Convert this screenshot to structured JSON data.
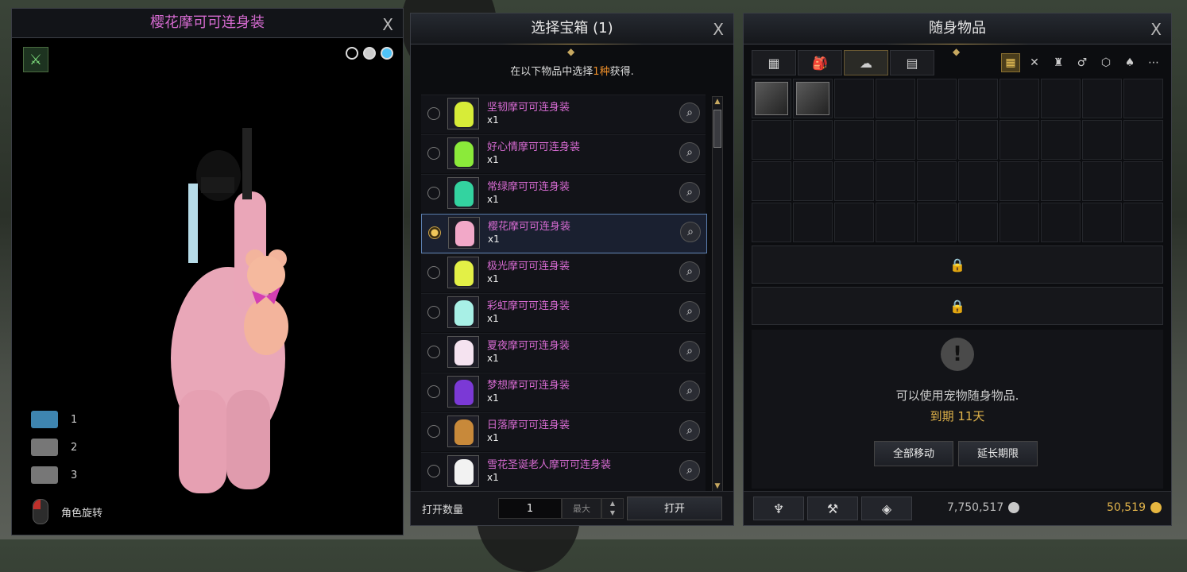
{
  "preview": {
    "title": "樱花摩可可连身装",
    "close": "X",
    "color_dots": [
      "#000000",
      "#cccccc",
      "#4fc3f7"
    ],
    "cameras": [
      {
        "label": "1"
      },
      {
        "label": "2"
      },
      {
        "label": "3"
      }
    ],
    "rotate_label": "角色旋转"
  },
  "chest": {
    "title": "选择宝箱 (1)",
    "close": "X",
    "instruction_pre": "在以下物品中选择",
    "instruction_hl": "1种",
    "instruction_post": "获得.",
    "items": [
      {
        "name": "坚韧摩可可连身装",
        "qty": "x1",
        "color": "#d7ec38",
        "selected": false
      },
      {
        "name": "好心情摩可可连身装",
        "qty": "x1",
        "color": "#8bea3a",
        "selected": false
      },
      {
        "name": "常绿摩可可连身装",
        "qty": "x1",
        "color": "#33d3a0",
        "selected": false
      },
      {
        "name": "樱花摩可可连身装",
        "qty": "x1",
        "color": "#f2a8c8",
        "selected": true
      },
      {
        "name": "极光摩可可连身装",
        "qty": "x1",
        "color": "#e3f046",
        "selected": false
      },
      {
        "name": "彩虹摩可可连身装",
        "qty": "x1",
        "color": "#a8f0e6",
        "selected": false
      },
      {
        "name": "夏夜摩可可连身装",
        "qty": "x1",
        "color": "#f5e3f0",
        "selected": false
      },
      {
        "name": "梦想摩可可连身装",
        "qty": "x1",
        "color": "#7b39d6",
        "selected": false
      },
      {
        "name": "日落摩可可连身装",
        "qty": "x1",
        "color": "#c8893a",
        "selected": false
      },
      {
        "name": "雪花圣诞老人摩可可连身装",
        "qty": "x1",
        "color": "#f2f2f2",
        "selected": false
      }
    ],
    "open_count_label": "打开数量",
    "count_value": "1",
    "max_label": "最大",
    "open_button": "打开"
  },
  "inventory": {
    "title": "随身物品",
    "close": "X",
    "pet_message": "可以使用宠物随身物品.",
    "pet_expiry": "到期 11天",
    "move_all": "全部移动",
    "extend": "延长期限",
    "silver": "7,750,517",
    "gold": "50,519"
  }
}
